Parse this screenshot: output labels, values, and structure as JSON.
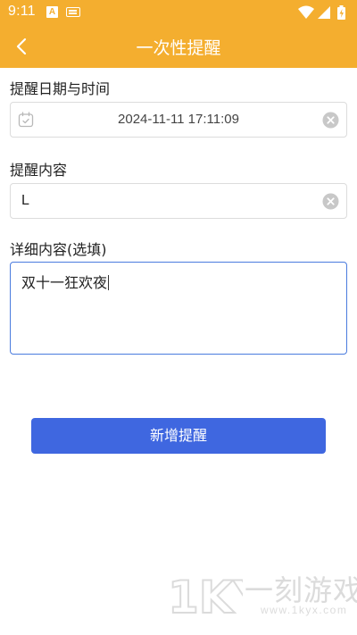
{
  "status_bar": {
    "time": "9:11",
    "a_badge": "A",
    "icons": [
      "a-notification-icon",
      "keyboard-icon",
      "wifi-icon",
      "signal-icon",
      "battery-charging-icon"
    ]
  },
  "app_bar": {
    "title": "一次性提醒",
    "back_icon": "chevron-left-icon"
  },
  "form": {
    "datetime_label": "提醒日期与时间",
    "datetime_value": "2024-11-11 17:11:09",
    "content_label": "提醒内容",
    "content_value": "L",
    "detail_label": "详细内容(选填)",
    "detail_value": "双十一狂欢夜",
    "submit_label": "新增提醒"
  },
  "watermark": {
    "logo": "1KY",
    "text": "一刻游戏网",
    "url": "www.1kyx.com"
  },
  "colors": {
    "header": "#F4AE2F",
    "primary_button": "#3F67E0",
    "focus_border": "#4a7bde"
  }
}
